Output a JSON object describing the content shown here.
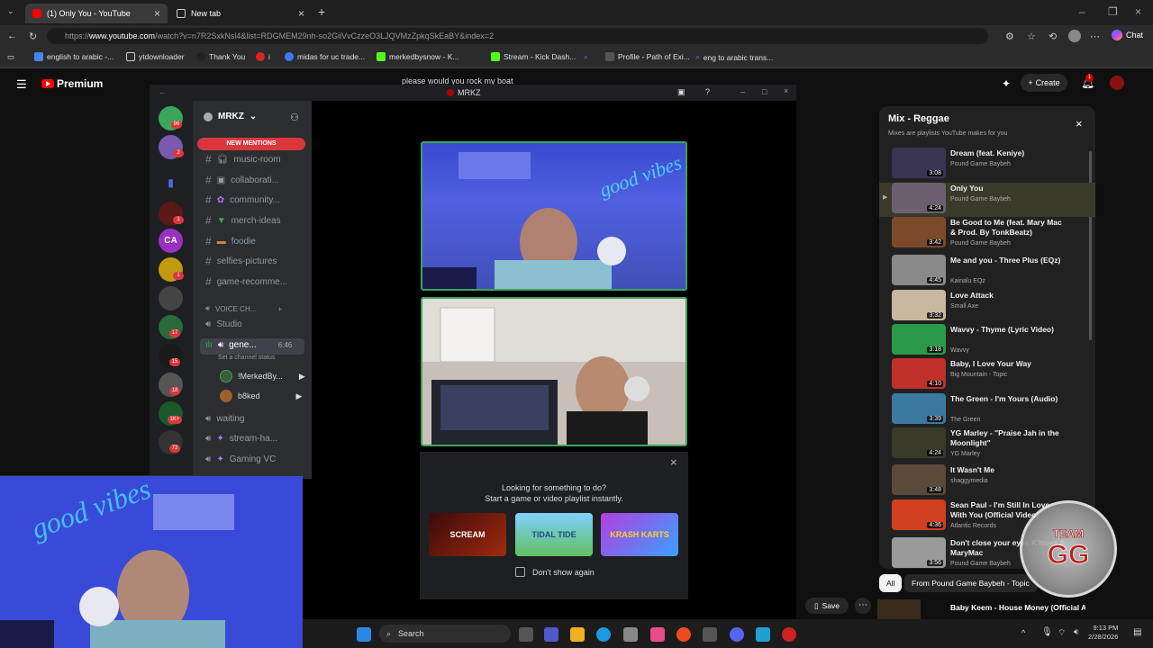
{
  "browser": {
    "tabs": [
      {
        "label": "(1) Only You - YouTube",
        "active": true
      },
      {
        "label": "New tab",
        "active": false
      }
    ],
    "url_prefix": "https://",
    "url_host": "www.youtube.com",
    "url_path": "/watch?v=n7R2SxkNsl4&list=RDGMEM29nh-so2GiiVvCzzeO3LJQVMzZpkqSkEaBY&index=2",
    "chat_label": "Chat",
    "bookmarks": [
      "english to arabic -...",
      "ytdownloader",
      "Thank You",
      "i",
      "midas for uc trade...",
      "merkedbysnow - K...",
      "Stream - Kick Dash...",
      "Profile - Path of Exi...",
      "eng to arabic trans..."
    ]
  },
  "youtube": {
    "logo": "Premium",
    "search_text": "please would you rock my boat",
    "create_label": "Create",
    "notif_count": "1",
    "playlist": {
      "title": "Mix - Reggae",
      "subtitle": "Mixes are playlists YouTube makes for you",
      "items": [
        {
          "title": "Dream (feat. Keniye)",
          "channel": "Pound Game Baybeh",
          "duration": "3:08",
          "color": "#3a3550"
        },
        {
          "title": "Only You",
          "channel": "Pound Game Baybeh",
          "duration": "4:24",
          "color": "#6a6070",
          "current": true
        },
        {
          "title": "Be Good to Me (feat. Mary Mac & Prod. By TonkBeatz)",
          "channel": "Pound Game Baybeh",
          "duration": "3:42",
          "color": "#7a4a2a"
        },
        {
          "title": "Me and you - Three Plus (EQz)",
          "channel": "Kainalu EQz",
          "duration": "4:45",
          "color": "#8a8a8a"
        },
        {
          "title": "Love Attack",
          "channel": "Small Axe",
          "duration": "3:32",
          "color": "#c8b8a0"
        },
        {
          "title": "Wavvy - Thyme (Lyric Video)",
          "channel": "Wavvy",
          "duration": "3:18",
          "color": "#2a9a4a"
        },
        {
          "title": "Baby, I Love Your Way",
          "channel": "Big Mountain - Topic",
          "duration": "4:10",
          "color": "#c0302a"
        },
        {
          "title": "The Green - I'm Yours (Audio)",
          "channel": "The Green",
          "duration": "3:39",
          "color": "#3a7aa0"
        },
        {
          "title": "YG Marley - \"Praise Jah in the Moonlight\"",
          "channel": "YG Marley",
          "duration": "4:24",
          "color": "#3a3a2a"
        },
        {
          "title": "It Wasn't Me",
          "channel": "shaggymedia",
          "duration": "3:48",
          "color": "#5a4a3a"
        },
        {
          "title": "Sean Paul - I'm Still In Love With You (Official Video)",
          "channel": "Atlantic Records",
          "duration": "4:36",
          "color": "#d04020"
        },
        {
          "title": "Don't close your eyes K'Nova & MaryMac",
          "channel": "Pound Game Baybeh",
          "duration": "3:56",
          "color": "#9a9a9a"
        }
      ],
      "chips": [
        "All",
        "From Pound Game Baybeh - Topic"
      ],
      "bottom_item": "Baby Keem - House Money (Official Audio)"
    },
    "save_label": "Save"
  },
  "discord": {
    "window_title": "MRKZ",
    "server_name": "MRKZ",
    "new_mentions": "NEW MENTIONS",
    "channels": [
      {
        "icon": "headphones",
        "name": "music-room"
      },
      {
        "icon": "image",
        "name": "collaborati..."
      },
      {
        "icon": "people",
        "name": "community..."
      },
      {
        "icon": "shirt",
        "name": "merch-ideas"
      },
      {
        "icon": "food",
        "name": "foodie"
      },
      {
        "icon": "",
        "name": "selfies-pictures"
      },
      {
        "icon": "",
        "name": "game-recomme..."
      }
    ],
    "voice_category": "VOICE CH...",
    "voice_channels": {
      "studio": "Studio",
      "general": "gene...",
      "general_time": "6:46",
      "status_hint": "Set a channel status",
      "members": [
        "!MerkedBy...",
        "b8ked"
      ],
      "waiting": "waiting",
      "stream": "stream-ha...",
      "gaming": "Gaming VC"
    },
    "server_badges": [
      "96",
      "2",
      "1",
      "1",
      "1",
      "17",
      "15",
      "18",
      "1K+",
      "73"
    ],
    "activity": {
      "line1": "Looking for something to do?",
      "line2": "Start a game or video playlist instantly.",
      "games": [
        "SCREAM",
        "TIDAL TIDE",
        "KRASH KARTS"
      ],
      "dont_show": "Don't show again"
    }
  },
  "overlay": {
    "team_label": "TEAM",
    "team_short": "GG"
  },
  "taskbar": {
    "search": "Search",
    "time": "9:13 PM",
    "date": "2/28/2026"
  }
}
